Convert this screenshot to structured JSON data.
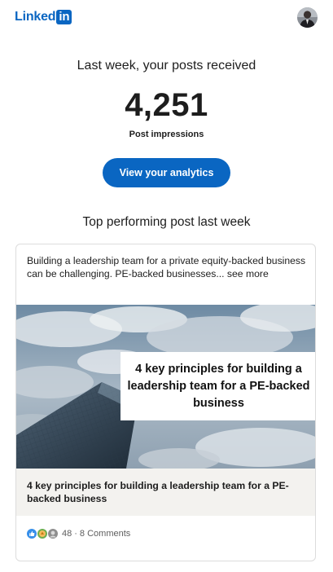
{
  "header": {
    "logo_word": "Linked",
    "logo_box": "in"
  },
  "summary": {
    "title": "Last week, your posts received",
    "impressions": "4,251",
    "impressions_label": "Post impressions",
    "analytics_button": "View your analytics"
  },
  "top_post": {
    "section_title": "Top performing post last week",
    "text": "Building a leadership team for a private equity-backed business can be challenging. PE-backed businesses... see more",
    "image_overlay_text": "4 key principles for building a leadership team for a PE-backed business",
    "article_title": "4 key principles for building a leadership team for a PE-backed business",
    "reaction_count": "48",
    "separator": "·",
    "comments": "8 Comments"
  },
  "colors": {
    "brand_blue": "#0a66c2",
    "text": "#1d1d1d",
    "muted": "#5e5e5e",
    "card_border": "#dcdcdc",
    "article_bg": "#f3f2ef"
  },
  "icons": {
    "reactions": [
      "like-reaction-icon",
      "celebrate-reaction-icon",
      "support-reaction-icon"
    ]
  }
}
